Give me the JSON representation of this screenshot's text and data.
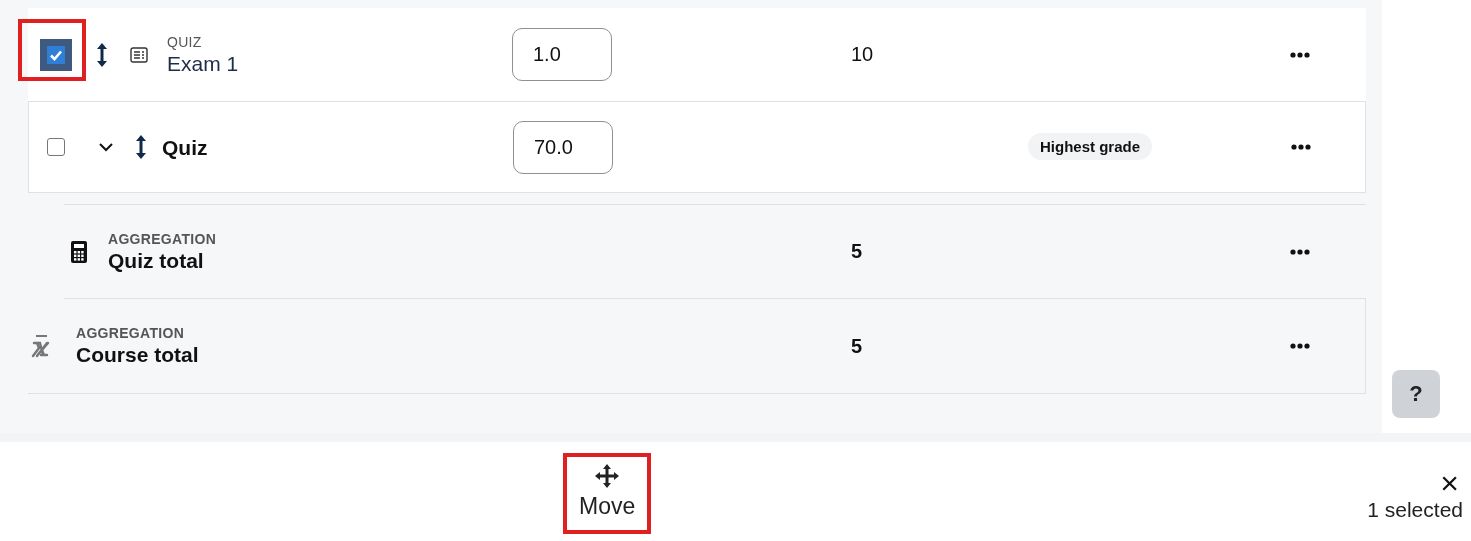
{
  "rows": [
    {
      "kind": "item",
      "selected": true,
      "highlighted": true,
      "type_label": "QUIZ",
      "name": "Exam 1",
      "weight": "1.0",
      "max_grade": "10"
    },
    {
      "kind": "category",
      "selected": false,
      "expanded": true,
      "name": "Quiz",
      "weight": "70.0",
      "aggregation": "Highest grade"
    },
    {
      "kind": "category_total",
      "type_label": "AGGREGATION",
      "name": "Quiz total",
      "max_grade": "5"
    },
    {
      "kind": "course_total",
      "type_label": "AGGREGATION",
      "name": "Course total",
      "max_grade": "5"
    }
  ],
  "help": "?",
  "action_bar": {
    "actions": [
      {
        "label": "Move",
        "highlighted": true
      }
    ],
    "close": "×",
    "selection_count": "1 selected"
  }
}
